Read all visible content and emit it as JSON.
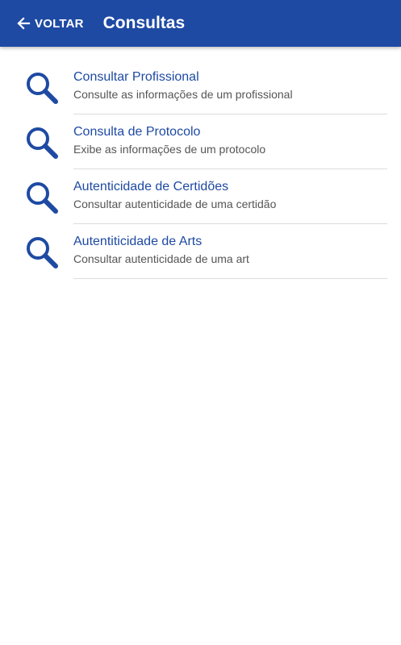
{
  "appbar": {
    "back_label": "VOLTAR",
    "back_icon": "arrow-left-icon",
    "title": "Consultas",
    "background": "#1e4aa3"
  },
  "items": [
    {
      "title": "Consultar Profissional",
      "subtitle": "Consulte as informações de um profissional",
      "icon": "search-icon"
    },
    {
      "title": "Consulta de Protocolo",
      "subtitle": "Exibe as informações de um protocolo",
      "icon": "search-icon"
    },
    {
      "title": "Autenticidade de Certidões",
      "subtitle": "Consultar autenticidade de uma certidão",
      "icon": "search-icon"
    },
    {
      "title": "Autentiticidade de Arts",
      "subtitle": "Consultar autenticidade de uma art",
      "icon": "search-icon"
    }
  ],
  "colors": {
    "accent": "#1e4aa3",
    "subtitle": "#555555",
    "divider": "#dcdcdc"
  }
}
